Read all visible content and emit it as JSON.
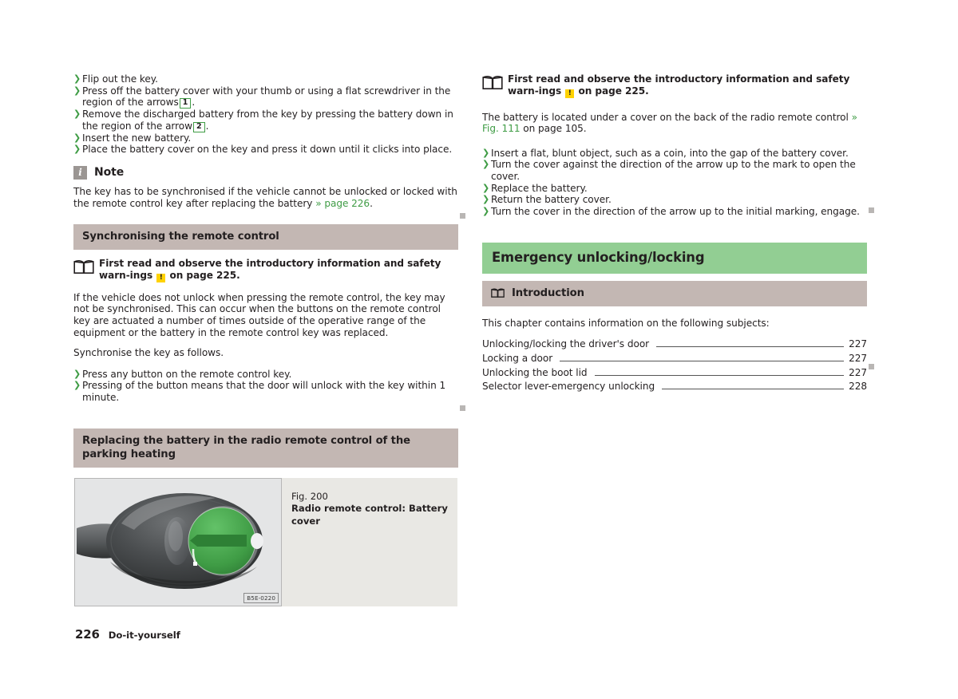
{
  "document": {
    "page_number": "226",
    "footer_section": "Do-it-yourself"
  },
  "left_column": {
    "steps_battery_replacement": [
      "Flip out the key.",
      "Press off the battery cover with your thumb or using a flat screwdriver in the region of the arrows",
      "Remove the discharged battery from the key by pressing the battery down in the region of the arrow",
      "Insert the new battery.",
      "Place the battery cover on the key and press it down until it clicks into place."
    ],
    "callout_1": "1",
    "callout_2": "2",
    "note": {
      "icon": "info-icon",
      "icon_glyph": "i",
      "title": "Note",
      "text_before_link": "The key has to be synchronised if the vehicle cannot be unlocked or locked with the remote control key after replacing the battery",
      "link": "» page 226",
      "text_after_link": "."
    },
    "section_sync": {
      "heading": "Synchronising the remote control",
      "readfirst": {
        "icon": "open-book-icon",
        "part1": "First read and observe the introductory information and safety warn-ings",
        "warn_glyph": "!",
        "part2": "on page 225."
      },
      "paragraph_1": "If the vehicle does not unlock when pressing the remote control, the key may not be synchronised. This can occur when the buttons on the remote control key are actuated a number of times outside of the operative range of the equipment or the battery in the remote control key was replaced.",
      "paragraph_2": "Synchronise the key as follows.",
      "steps": [
        "Press any button on the remote control key.",
        "Pressing of the button means that the door will unlock with the key within 1 minute."
      ]
    },
    "section_parking_heating": {
      "heading": "Replacing the battery in the radio remote control of the parking heating",
      "figure": {
        "number": "Fig. 200",
        "title": "Radio remote control: Battery cover",
        "code": "B5E-0220",
        "illustration": "radio-remote-control-key-fob"
      }
    }
  },
  "right_column": {
    "readfirst": {
      "icon": "open-book-icon",
      "part1": "First read and observe the introductory information and safety warn-ings",
      "warn_glyph": "!",
      "part2": "on page 225."
    },
    "paragraph_battery_location": {
      "text_before_link": "The battery is located under a cover on the back of the radio remote control",
      "link": "» Fig. 111",
      "text_after_link": "on page 105."
    },
    "steps": [
      "Insert a flat, blunt object, such as a coin, into the gap of the battery cover.",
      "Turn the cover against the direction of the arrow up to the mark to open the cover.",
      "Replace the battery.",
      "Return the battery cover.",
      "Turn the cover in the direction of the arrow up to the initial marking, engage."
    ],
    "section_emergency": {
      "heading": "Emergency unlocking/locking",
      "subheading": "Introduction",
      "subheading_icon": "open-book-icon",
      "intro_text": "This chapter contains information on the following subjects:",
      "toc": [
        {
          "label": "Unlocking/locking the driver's door",
          "page": "227"
        },
        {
          "label": "Locking a door",
          "page": "227"
        },
        {
          "label": "Unlocking the boot lid",
          "page": "227"
        },
        {
          "label": "Selector lever-emergency unlocking",
          "page": "228"
        }
      ]
    }
  },
  "colors": {
    "accent_green": "#3f9c45",
    "heading_green": "#92ce93",
    "heading_grey": "#c3b7b3",
    "warning_yellow": "#ffd200",
    "note_grey": "#9b9693",
    "endmark_grey": "#b9b6b4"
  }
}
